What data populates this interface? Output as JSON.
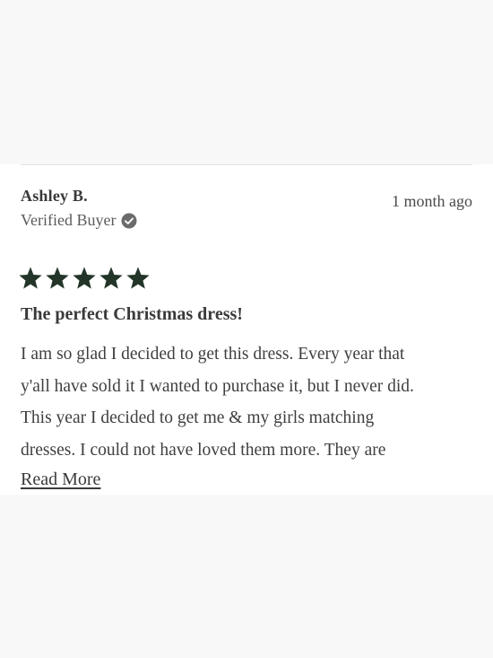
{
  "review": {
    "reviewer_name": "Ashley B.",
    "verified_label": "Verified Buyer",
    "date": "1 month ago",
    "rating": 5,
    "rating_max": 5,
    "title": "The perfect Christmas dress!",
    "body_lines": [
      "I am so glad I decided to get this dress. Every year that",
      "y'all have sold it I wanted to purchase it, but I never did.",
      "This year I decided to get me & my girls matching",
      "dresses. I could not have loved them more. They are"
    ],
    "read_more_label": "Read More"
  },
  "icons": {
    "verified": "check-circle-icon",
    "star": "star-icon"
  },
  "colors": {
    "star_fill": "#233528",
    "verified_badge": "#6b6b6b",
    "text": "#3a3a3a",
    "divider": "#e4e4e4"
  }
}
